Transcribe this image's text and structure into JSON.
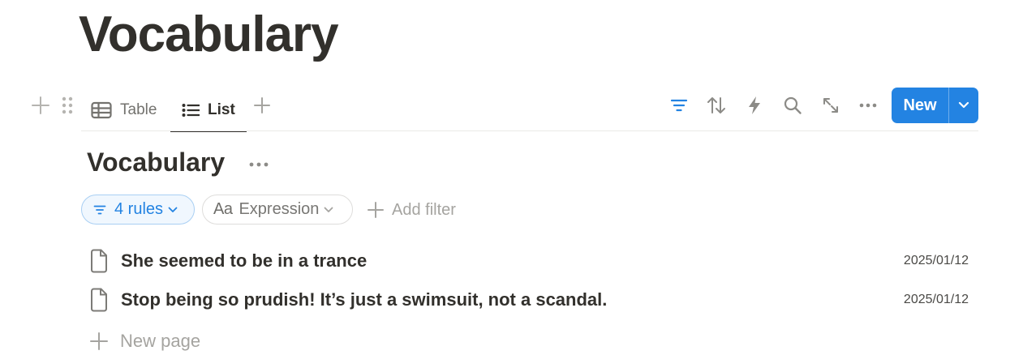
{
  "page": {
    "title": "Vocabulary"
  },
  "views": {
    "tabs": [
      {
        "label": "Table",
        "icon": "table-icon",
        "active": false
      },
      {
        "label": "List",
        "icon": "list-icon",
        "active": true
      }
    ],
    "add_view_icon": "plus-icon"
  },
  "toolbar": {
    "icons": [
      "filter-icon",
      "sort-icon",
      "automation-icon",
      "search-icon",
      "expand-icon",
      "more-icon"
    ],
    "new_label": "New",
    "accent": "#2383e2"
  },
  "list": {
    "title": "Vocabulary",
    "filters": {
      "rules_label": "4 rules",
      "property_label": "Expression",
      "property_icon_text": "Aa",
      "add_filter_label": "Add filter"
    },
    "rows": [
      {
        "title": "She seemed to be in a trance",
        "date": "2025/01/12"
      },
      {
        "title": "Stop being so prudish! It’s just a swimsuit, not a scandal.",
        "date": "2025/01/12"
      }
    ],
    "new_page_label": "New page"
  }
}
